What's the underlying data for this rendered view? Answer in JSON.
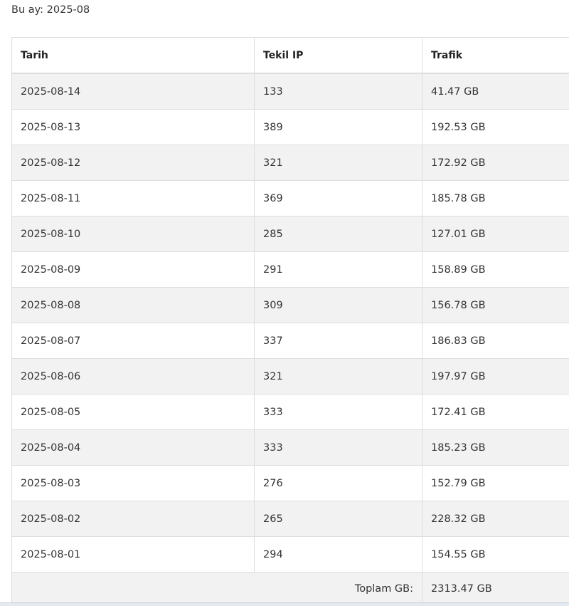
{
  "header": {
    "month_line": "Bu ay: 2025-08"
  },
  "table": {
    "columns": [
      "Tarih",
      "Tekil IP",
      "Trafik"
    ],
    "rows": [
      {
        "date": "2025-08-14",
        "unique_ip": "133",
        "traffic": "41.47 GB"
      },
      {
        "date": "2025-08-13",
        "unique_ip": "389",
        "traffic": "192.53 GB"
      },
      {
        "date": "2025-08-12",
        "unique_ip": "321",
        "traffic": "172.92 GB"
      },
      {
        "date": "2025-08-11",
        "unique_ip": "369",
        "traffic": "185.78 GB"
      },
      {
        "date": "2025-08-10",
        "unique_ip": "285",
        "traffic": "127.01 GB"
      },
      {
        "date": "2025-08-09",
        "unique_ip": "291",
        "traffic": "158.89 GB"
      },
      {
        "date": "2025-08-08",
        "unique_ip": "309",
        "traffic": "156.78 GB"
      },
      {
        "date": "2025-08-07",
        "unique_ip": "337",
        "traffic": "186.83 GB"
      },
      {
        "date": "2025-08-06",
        "unique_ip": "321",
        "traffic": "197.97 GB"
      },
      {
        "date": "2025-08-05",
        "unique_ip": "333",
        "traffic": "172.41 GB"
      },
      {
        "date": "2025-08-04",
        "unique_ip": "333",
        "traffic": "185.23 GB"
      },
      {
        "date": "2025-08-03",
        "unique_ip": "276",
        "traffic": "152.79 GB"
      },
      {
        "date": "2025-08-02",
        "unique_ip": "265",
        "traffic": "228.32 GB"
      },
      {
        "date": "2025-08-01",
        "unique_ip": "294",
        "traffic": "154.55 GB"
      }
    ],
    "footer": {
      "total_label": "Toplam GB:",
      "total_value": "2313.47 GB"
    }
  }
}
